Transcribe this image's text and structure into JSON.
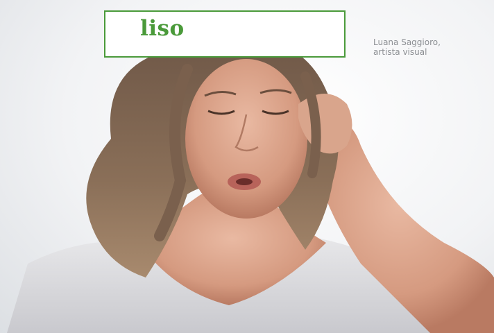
{
  "overlay": {
    "word": "liso",
    "word_color": "#4a9a3a"
  },
  "caption": {
    "name": "Luana Saggioro,",
    "role": "artista visual"
  },
  "photo": {
    "subject": "woman-with-curly-hair-touching-head"
  }
}
